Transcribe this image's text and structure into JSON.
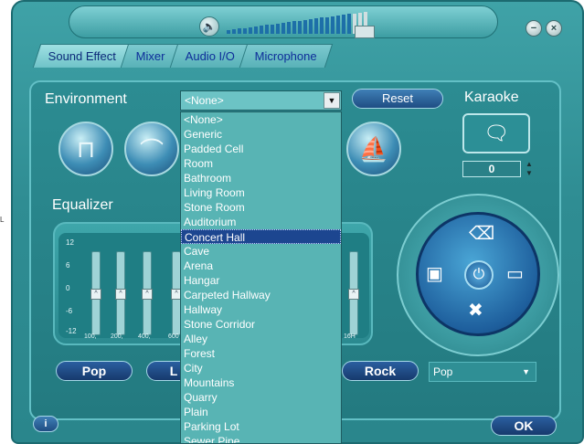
{
  "tabs": [
    {
      "label": "Sound Effect",
      "active": true
    },
    {
      "label": "Mixer",
      "active": false
    },
    {
      "label": "Audio I/O",
      "active": false
    },
    {
      "label": "Microphone",
      "active": false
    }
  ],
  "window_buttons": {
    "minimize": "−",
    "close": "×"
  },
  "environment": {
    "label": "Environment",
    "selected": "<None>",
    "reset_label": "Reset",
    "icons": [
      "headphones-icon",
      "shower-icon",
      "opera-house-icon"
    ]
  },
  "karaoke": {
    "label": "Karaoke",
    "value": "0"
  },
  "equalizer": {
    "label": "Equalizer",
    "scale": [
      "12",
      "6",
      "0",
      "-6",
      "-12"
    ],
    "bands": [
      "100,",
      "200,",
      "400,",
      "600",
      "16H"
    ]
  },
  "presets": {
    "pop_label": "Pop",
    "second_label": "L",
    "rock_label": "Rock",
    "selected": "Pop"
  },
  "dropdown_items": [
    "<None>",
    "Generic",
    "Padded Cell",
    "Room",
    "Bathroom",
    "Living Room",
    "Stone Room",
    "Auditorium",
    "Concert Hall",
    "Cave",
    "Arena",
    "Hangar",
    "Carpeted Hallway",
    "Hallway",
    "Stone Corridor",
    "Alley",
    "Forest",
    "City",
    "Mountains",
    "Quarry",
    "Plain",
    "Parking Lot",
    "Sewer Pipe"
  ],
  "dropdown_selected_index": 8,
  "ok_label": "OK",
  "info_label": "i",
  "left_fragment": "L"
}
